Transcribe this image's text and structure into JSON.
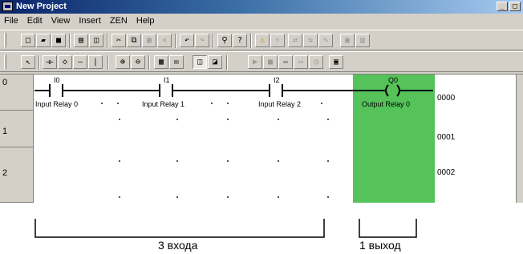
{
  "window": {
    "title": "New Project",
    "minimize": "_",
    "restore": "□"
  },
  "menu": [
    "File",
    "Edit",
    "View",
    "Insert",
    "ZEN",
    "Help"
  ],
  "toolbar1": [
    {
      "name": "new-icon",
      "glyph": "□"
    },
    {
      "name": "open-icon",
      "glyph": "▰"
    },
    {
      "name": "save-icon",
      "glyph": "■"
    },
    {
      "name": "print-icon",
      "glyph": "▤"
    },
    {
      "name": "print-preview-icon",
      "glyph": "◫"
    },
    {
      "name": "cut-icon",
      "glyph": "✂"
    },
    {
      "name": "copy-icon",
      "glyph": "⧉"
    },
    {
      "name": "paste-icon",
      "glyph": "▦"
    },
    {
      "name": "delete-icon",
      "glyph": "✕"
    },
    {
      "name": "undo-icon",
      "glyph": "↶"
    },
    {
      "name": "redo-icon",
      "glyph": "↷"
    },
    {
      "name": "find-icon",
      "glyph": "⚲"
    },
    {
      "name": "help-icon",
      "glyph": "?"
    },
    {
      "name": "warning-icon",
      "glyph": "⚠"
    },
    {
      "name": "online-icon",
      "glyph": "⚡"
    },
    {
      "name": "transfer-icon",
      "glyph": "⇄"
    },
    {
      "name": "compare-icon",
      "glyph": "⇆"
    },
    {
      "name": "edit-online-icon",
      "glyph": "✎"
    },
    {
      "name": "monitor-icon",
      "glyph": "▣"
    },
    {
      "name": "monitor2-icon",
      "glyph": "▥"
    }
  ],
  "toolbar2": [
    {
      "name": "select-icon",
      "glyph": "↖"
    },
    {
      "name": "contact-icon",
      "glyph": "⊣⊢"
    },
    {
      "name": "coil-icon",
      "glyph": "◇"
    },
    {
      "name": "horizontal-line-icon",
      "glyph": "—"
    },
    {
      "name": "vertical-line-icon",
      "glyph": "|"
    },
    {
      "name": "zoom-in-icon",
      "glyph": "⊕"
    },
    {
      "name": "zoom-out-icon",
      "glyph": "⊖"
    },
    {
      "name": "grid-icon",
      "glyph": "▦"
    },
    {
      "name": "comment-icon",
      "glyph": "✉"
    },
    {
      "name": "show-address-icon",
      "glyph": "◫"
    },
    {
      "name": "show-comment-icon",
      "glyph": "◪"
    },
    {
      "name": "run-icon",
      "glyph": "▶"
    },
    {
      "name": "stop-icon",
      "glyph": "■"
    },
    {
      "name": "mode-icon",
      "glyph": "▬"
    },
    {
      "name": "program-icon",
      "glyph": "▭"
    },
    {
      "name": "clock-icon",
      "glyph": "◷"
    },
    {
      "name": "settings-icon",
      "glyph": "▣"
    }
  ],
  "rungs": [
    {
      "number": "0",
      "address": "0000"
    },
    {
      "number": "1",
      "address": "0001"
    },
    {
      "number": "2",
      "address": "0002"
    }
  ],
  "contacts": [
    {
      "symbol": "I0",
      "comment": "Input Relay 0"
    },
    {
      "symbol": "I1",
      "comment": "Input Relay 1"
    },
    {
      "symbol": "I2",
      "comment": "Input Relay 2"
    }
  ],
  "coil": {
    "symbol": "Q0",
    "comment": "Output Relay 0"
  },
  "annotations": {
    "inputs": "3 входа",
    "outputs": "1 выход"
  },
  "colors": {
    "highlight": "#55c35a"
  }
}
